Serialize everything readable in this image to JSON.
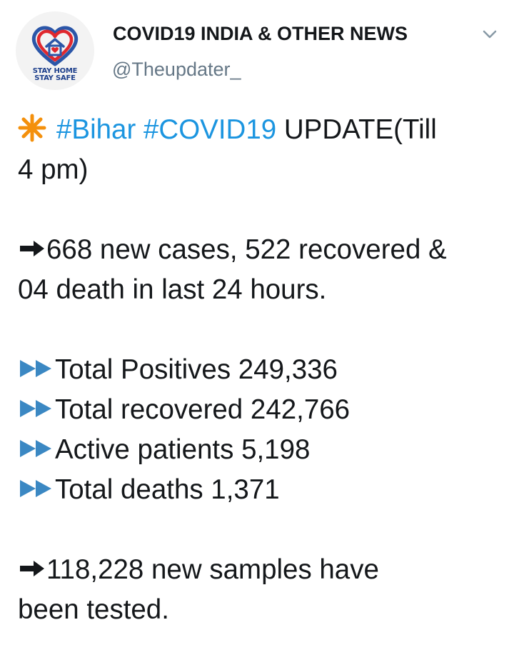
{
  "account": {
    "display_name": "COVID19 INDIA & OTHER NEWS",
    "handle": "@Theupdater_",
    "avatar_text_line1": "STAY HOME",
    "avatar_text_line2": "STAY SAFE"
  },
  "colors": {
    "hashtag": "#1b95e0",
    "text": "#14171a",
    "handle": "#657786",
    "sparkle": "#f4900c",
    "fast_forward": "#3b88c3"
  },
  "tweet": {
    "intro": {
      "icon": "eight-spoked-asterisk-icon",
      "hashtag1": "#Bihar",
      "hashtag2": "#COVID19",
      "rest1": " UPDATE(Till",
      "rest2": "4 pm)"
    },
    "daily": {
      "icon": "right-arrow-icon",
      "line1": "668 new cases, 522 recovered &",
      "line2": "04 death in last 24 hours."
    },
    "totals": [
      {
        "icon": "fast-forward-icon",
        "text": "Total Positives 249,336"
      },
      {
        "icon": "fast-forward-icon",
        "text": "Total recovered 242,766"
      },
      {
        "icon": "fast-forward-icon",
        "text": "Active patients 5,198"
      },
      {
        "icon": "fast-forward-icon",
        "text": "Total deaths 1,371"
      }
    ],
    "samples": {
      "icon": "right-arrow-icon",
      "line1": "118,228 new samples have",
      "line2": "been tested."
    }
  }
}
